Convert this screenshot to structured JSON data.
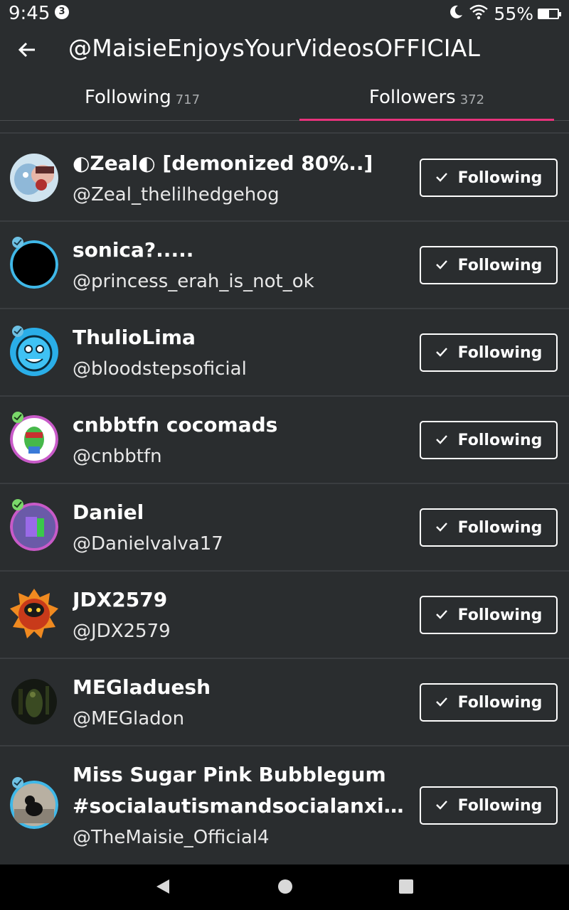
{
  "status_bar": {
    "time": "9:45",
    "notification_count": "3",
    "battery_percent": "55%",
    "battery_level": 0.55,
    "icons": [
      "moon-icon",
      "wifi-icon",
      "battery-icon"
    ]
  },
  "header": {
    "title": "@MaisieEnjoysYourVideosOFFICIAL",
    "back_icon": "arrow-left-icon"
  },
  "tabs": [
    {
      "label": "Following",
      "count": "717",
      "selected": false
    },
    {
      "label": "Followers",
      "count": "372",
      "selected": true
    }
  ],
  "accent_color": "#e8337c",
  "users": [
    {
      "display_name": "◐Zeal◐ [demonized 80%..]",
      "username": "@Zeal_thelilhedgehog",
      "button": "Following"
    },
    {
      "display_name": "sonica?.....",
      "username": "@princess_erah_is_not_ok",
      "button": "Following"
    },
    {
      "display_name": "ThulioLima",
      "username": "@bloodstepsoficial",
      "button": "Following"
    },
    {
      "display_name": "cnbbtfn cocomads",
      "username": "@cnbbtfn",
      "button": "Following"
    },
    {
      "display_name": "Daniel",
      "username": "@Danielvalva17",
      "button": "Following"
    },
    {
      "display_name": "JDX2579",
      "username": "@JDX2579",
      "button": "Following"
    },
    {
      "display_name": "MEGladuesh",
      "username": "@MEGladon",
      "button": "Following"
    },
    {
      "display_name_line1": "Miss Sugar Pink Bubblegum",
      "display_name_line2": "#socialautismandsocialanxie...",
      "username": "@TheMaisie_Official4",
      "button": "Following"
    }
  ],
  "nav": {
    "back": "nav-back-icon",
    "home": "nav-home-icon",
    "recents": "nav-recents-icon"
  }
}
